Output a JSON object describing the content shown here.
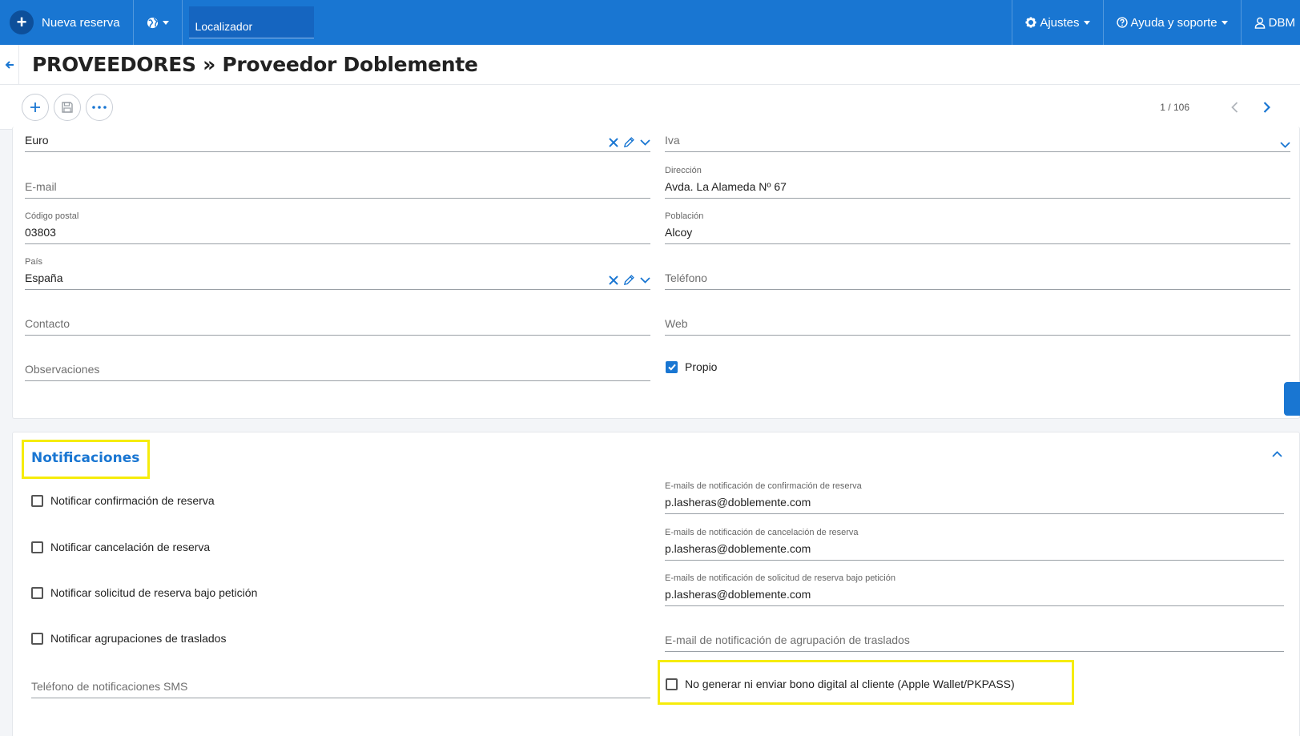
{
  "topbar": {
    "new_reservation": "Nueva reserva",
    "locator_placeholder": "Localizador",
    "settings": "Ajustes",
    "help": "Ayuda y soporte",
    "user": "DBM"
  },
  "title": "PROVEEDORES » Proveedor Doblemente",
  "pager": {
    "count": "1 / 106"
  },
  "form": {
    "currency": {
      "value": "Euro"
    },
    "tax": {
      "value": "Iva"
    },
    "email": {
      "placeholder": "E-mail"
    },
    "address": {
      "label": "Dirección",
      "value": "Avda. La Alameda Nº 67"
    },
    "postal_code": {
      "label": "Código postal",
      "value": "03803"
    },
    "town": {
      "label": "Población",
      "value": "Alcoy"
    },
    "country": {
      "label": "País",
      "value": "España"
    },
    "phone": {
      "placeholder": "Teléfono"
    },
    "contact": {
      "placeholder": "Contacto"
    },
    "web": {
      "placeholder": "Web"
    },
    "notes": {
      "placeholder": "Observaciones"
    },
    "own": {
      "label": "Propio",
      "checked": true
    }
  },
  "notifications": {
    "title": "Notificaciones",
    "checkboxes": [
      {
        "label": "Notificar confirmación de reserva",
        "checked": false
      },
      {
        "label": "Notificar cancelación de reserva",
        "checked": false
      },
      {
        "label": "Notificar solicitud de reserva bajo petición",
        "checked": false
      },
      {
        "label": "Notificar agrupaciones de traslados",
        "checked": false
      }
    ],
    "sms_phone": {
      "placeholder": "Teléfono de notificaciones SMS"
    },
    "email_confirmation": {
      "label": "E-mails de notificación de confirmación de reserva",
      "value": "p.lasheras@doblemente.com"
    },
    "email_cancellation": {
      "label": "E-mails de notificación de cancelación de reserva",
      "value": "p.lasheras@doblemente.com"
    },
    "email_on_request": {
      "label": "E-mails de notificación de solicitud de reserva bajo petición",
      "value": "p.lasheras@doblemente.com"
    },
    "email_transfer_group": {
      "placeholder": "E-mail de notificación de agrupación de traslados"
    },
    "no_digital_voucher": {
      "label": "No generar ni enviar bono digital al cliente (Apple Wallet/PKPASS)",
      "checked": false
    }
  },
  "colors": {
    "primary": "#1976d2",
    "highlight": "#f6ec0b"
  }
}
